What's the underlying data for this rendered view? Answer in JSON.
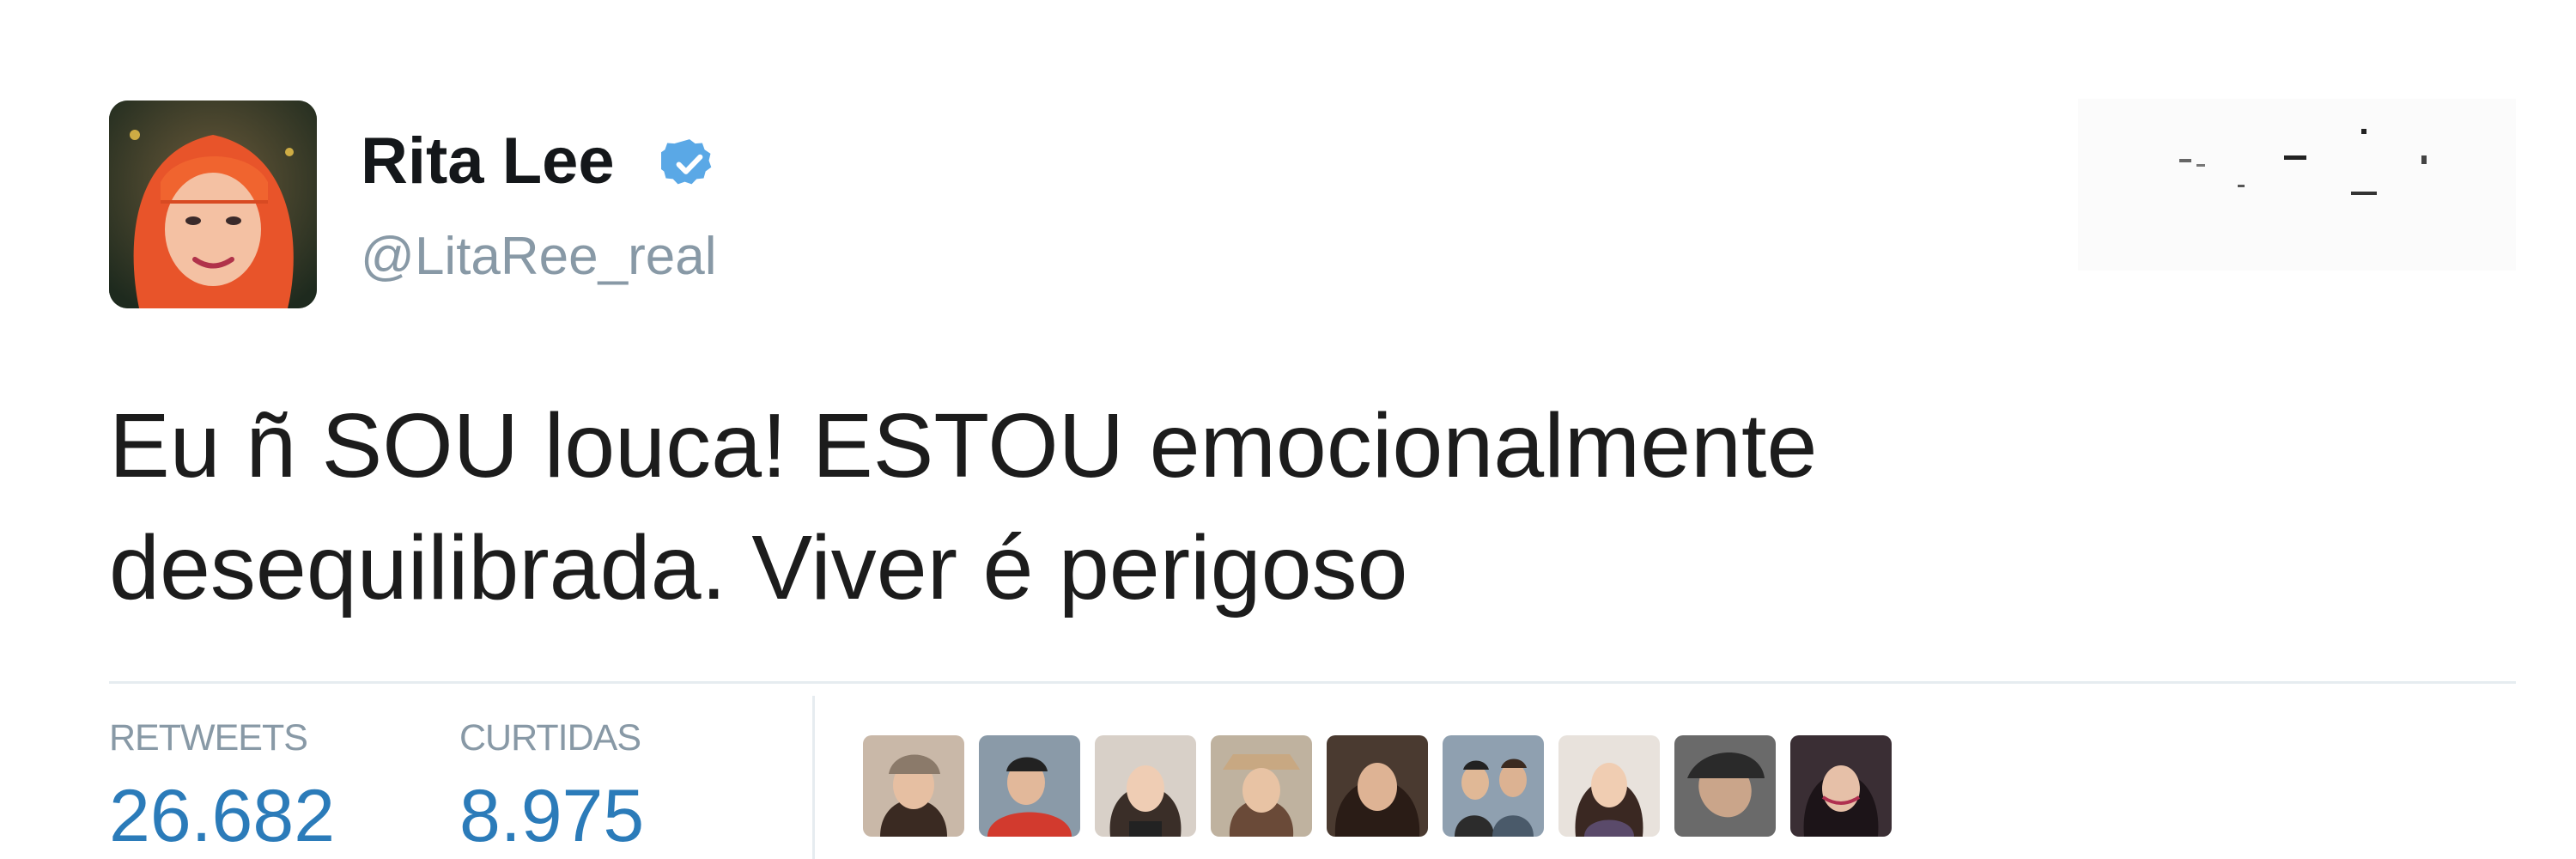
{
  "tweet": {
    "author": {
      "name": "Rita Lee",
      "handle": "@LitaRee_real",
      "verified": true
    },
    "text_line1": "Eu ñ SOU louca! ESTOU emocionalmente",
    "text_line2": "desequilibrada. Viver é perigoso",
    "stats": {
      "retweets_label": "RETWEETS",
      "retweets_value": "26.682",
      "likes_label": "CURTIDAS",
      "likes_value": "8.975"
    },
    "likers_count_shown": 9
  },
  "colors": {
    "name": "#14171a",
    "muted": "#8899a6",
    "stat_value": "#2b7bb9",
    "verified": "#5aa8e6",
    "divider": "#e6ecf0"
  },
  "icons": {
    "verified": "verified-check-icon"
  }
}
